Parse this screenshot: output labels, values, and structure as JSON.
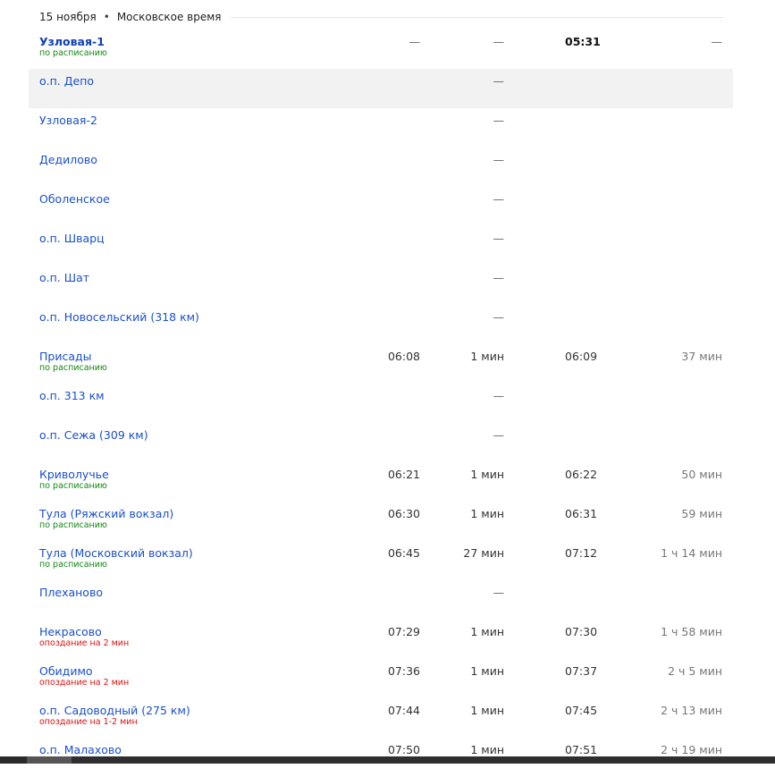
{
  "header": {
    "date": "15 ноября",
    "separator": "•",
    "timezone": "Московское время"
  },
  "rows": [
    {
      "name": "Узловая-1",
      "status": "по расписанию",
      "status_type": "ok",
      "arrival": "—",
      "stop": "—",
      "departure": "05:31",
      "travel": "—",
      "bold": true,
      "highlight": false
    },
    {
      "name": "о.п. Депо",
      "status": "",
      "status_type": "",
      "arrival": "",
      "stop": "—",
      "departure": "",
      "travel": "",
      "bold": false,
      "highlight": true
    },
    {
      "name": "Узловая-2",
      "status": "",
      "status_type": "",
      "arrival": "",
      "stop": "—",
      "departure": "",
      "travel": "",
      "bold": false,
      "highlight": false
    },
    {
      "name": "Дедилово",
      "status": "",
      "status_type": "",
      "arrival": "",
      "stop": "—",
      "departure": "",
      "travel": "",
      "bold": false,
      "highlight": false
    },
    {
      "name": "Оболенское",
      "status": "",
      "status_type": "",
      "arrival": "",
      "stop": "—",
      "departure": "",
      "travel": "",
      "bold": false,
      "highlight": false
    },
    {
      "name": "о.п. Шварц",
      "status": "",
      "status_type": "",
      "arrival": "",
      "stop": "—",
      "departure": "",
      "travel": "",
      "bold": false,
      "highlight": false
    },
    {
      "name": "о.п. Шат",
      "status": "",
      "status_type": "",
      "arrival": "",
      "stop": "—",
      "departure": "",
      "travel": "",
      "bold": false,
      "highlight": false
    },
    {
      "name": "о.п. Новосельский (318 км)",
      "status": "",
      "status_type": "",
      "arrival": "",
      "stop": "—",
      "departure": "",
      "travel": "",
      "bold": false,
      "highlight": false
    },
    {
      "name": "Присады",
      "status": "по расписанию",
      "status_type": "ok",
      "arrival": "06:08",
      "stop": "1 мин",
      "departure": "06:09",
      "travel": "37 мин",
      "bold": false,
      "highlight": false
    },
    {
      "name": "о.п. 313 км",
      "status": "",
      "status_type": "",
      "arrival": "",
      "stop": "—",
      "departure": "",
      "travel": "",
      "bold": false,
      "highlight": false
    },
    {
      "name": "о.п. Сежа (309 км)",
      "status": "",
      "status_type": "",
      "arrival": "",
      "stop": "—",
      "departure": "",
      "travel": "",
      "bold": false,
      "highlight": false
    },
    {
      "name": "Криволучье",
      "status": "по расписанию",
      "status_type": "ok",
      "arrival": "06:21",
      "stop": "1 мин",
      "departure": "06:22",
      "travel": "50 мин",
      "bold": false,
      "highlight": false
    },
    {
      "name": "Тула (Ряжский вокзал)",
      "status": "по расписанию",
      "status_type": "ok",
      "arrival": "06:30",
      "stop": "1 мин",
      "departure": "06:31",
      "travel": "59 мин",
      "bold": false,
      "highlight": false
    },
    {
      "name": "Тула (Московский вокзал)",
      "status": "по расписанию",
      "status_type": "ok",
      "arrival": "06:45",
      "stop": "27 мин",
      "departure": "07:12",
      "travel": "1 ч 14 мин",
      "bold": false,
      "highlight": false
    },
    {
      "name": "Плеханово",
      "status": "",
      "status_type": "",
      "arrival": "",
      "stop": "—",
      "departure": "",
      "travel": "",
      "bold": false,
      "highlight": false
    },
    {
      "name": "Некрасово",
      "status": "опоздание на 2 мин",
      "status_type": "late",
      "arrival": "07:29",
      "stop": "1 мин",
      "departure": "07:30",
      "travel": "1 ч 58 мин",
      "bold": false,
      "highlight": false
    },
    {
      "name": "Обидимо",
      "status": "опоздание на 2 мин",
      "status_type": "late",
      "arrival": "07:36",
      "stop": "1 мин",
      "departure": "07:37",
      "travel": "2 ч 5 мин",
      "bold": false,
      "highlight": false
    },
    {
      "name": "о.п. Садоводный (275 км)",
      "status": "опоздание на 1-2 мин",
      "status_type": "late",
      "arrival": "07:44",
      "stop": "1 мин",
      "departure": "07:45",
      "travel": "2 ч 13 мин",
      "bold": false,
      "highlight": false
    },
    {
      "name": "о.п. Малахово",
      "status": "",
      "status_type": "",
      "arrival": "07:50",
      "stop": "1 мин",
      "departure": "07:51",
      "travel": "2 ч 19 мин",
      "bold": false,
      "highlight": false
    }
  ]
}
